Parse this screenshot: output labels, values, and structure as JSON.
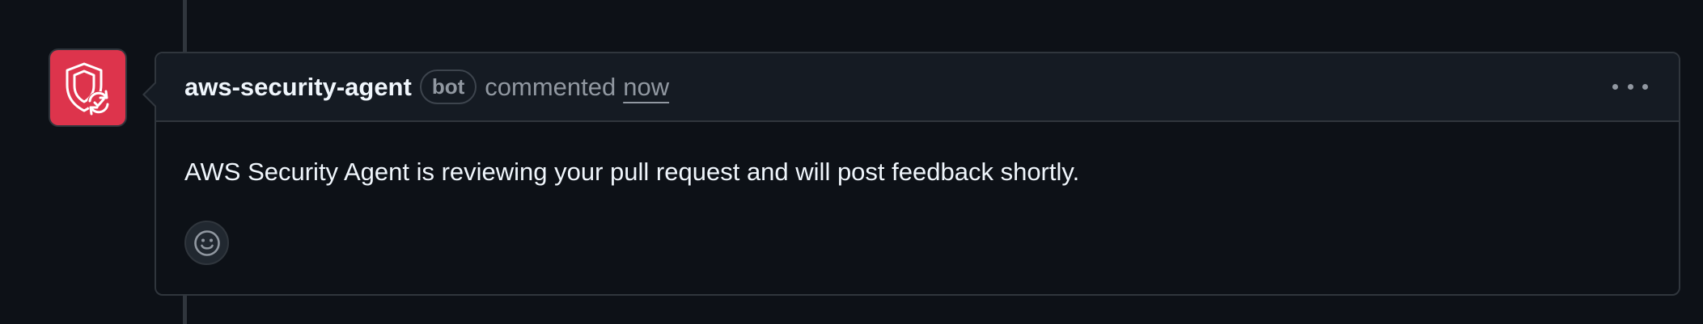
{
  "comment": {
    "author": "aws-security-agent",
    "badge": "bot",
    "action": "commented",
    "timestamp": "now",
    "body": "AWS Security Agent is reviewing your pull request and will post feedback shortly."
  },
  "avatar": {
    "icon": "shield-refresh-icon",
    "background_color": "#dd344c"
  },
  "colors": {
    "page_background": "#0d1117",
    "header_background": "#151b23",
    "border": "#30363d",
    "text_primary": "#f0f6fc",
    "text_muted": "#9198a1"
  }
}
